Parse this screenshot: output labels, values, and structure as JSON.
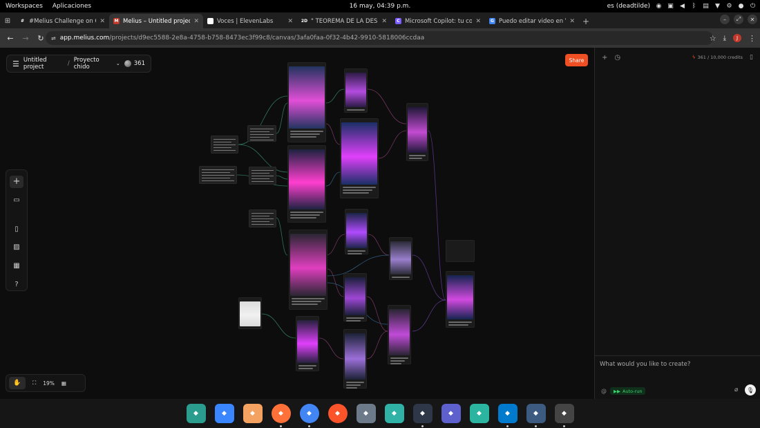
{
  "os": {
    "workspaces": "Workspaces",
    "apps": "Aplicaciones",
    "clock": "16 may, 04:39 p.m.",
    "lang": "es (deadtilde)"
  },
  "tabs": [
    {
      "title": "#Melius Challenge on C",
      "fav_color": "#1f1f1f",
      "fav_glyph": "#"
    },
    {
      "title": "Melius – Untitled project",
      "fav_color": "#c0392b",
      "fav_glyph": "M",
      "active": true
    },
    {
      "title": "Voces | ElevenLabs",
      "fav_color": "#ffffff",
      "fav_glyph": "II"
    },
    {
      "title": "\" TEOREMA DE LA DESI",
      "fav_color": "#1f1f1f",
      "fav_glyph": "2D"
    },
    {
      "title": "Microsoft Copilot: tu co",
      "fav_color": "#7b5cff",
      "fav_glyph": "C"
    },
    {
      "title": "Puedo editar video en V",
      "fav_color": "#4285f4",
      "fav_glyph": "G"
    }
  ],
  "address": {
    "host": "app.melius.com",
    "path": "/projects/d9ec5588-2e8a-4758-b758-8473ec3f99c8/canvas/3afa0faa-0f32-4b42-9910-5818006ccdaa",
    "profile_initial": "J"
  },
  "canvas": {
    "project": "Untitled project",
    "folder": "Proyecto chido",
    "credits": "361",
    "share": "Share",
    "zoom": "19%"
  },
  "panel": {
    "credits": "361 / 10,000 credits",
    "prompt_placeholder": "What would you like to create?",
    "autorun": "Auto-run"
  },
  "dock_apps": [
    {
      "name": "image-viewer",
      "color": "#2a9d8f"
    },
    {
      "name": "dashboard",
      "color": "#3a86ff"
    },
    {
      "name": "app-grid",
      "color": "#f4a261"
    },
    {
      "name": "firefox",
      "color": "#ff7139"
    },
    {
      "name": "chrome",
      "color": "#4285f4"
    },
    {
      "name": "brave",
      "color": "#fb542b"
    },
    {
      "name": "text-editor",
      "color": "#6c7a89"
    },
    {
      "name": "files",
      "color": "#30b3a6"
    },
    {
      "name": "terminal",
      "color": "#2d3748"
    },
    {
      "name": "store",
      "color": "#5e60ce"
    },
    {
      "name": "recorder",
      "color": "#2bb5a0"
    },
    {
      "name": "vscode",
      "color": "#007acc"
    },
    {
      "name": "video-editor",
      "color": "#3d5a80"
    },
    {
      "name": "screenshot",
      "color": "#444444"
    }
  ]
}
